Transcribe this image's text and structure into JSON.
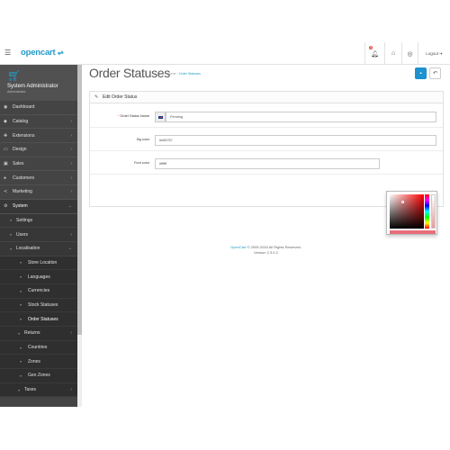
{
  "header": {
    "logo_text": "opencart",
    "logo_icon": "cart-icon",
    "alert_count": "3",
    "logout_label": "Logout"
  },
  "profile": {
    "name": "System Administrator",
    "role": "Administrator"
  },
  "sidebar": {
    "items": [
      {
        "label": "Dashboard",
        "icon": "dashboard-icon"
      },
      {
        "label": "Catalog",
        "icon": "tag-icon"
      },
      {
        "label": "Extensions",
        "icon": "puzzle-icon"
      },
      {
        "label": "Design",
        "icon": "monitor-icon"
      },
      {
        "label": "Sales",
        "icon": "cart-icon"
      },
      {
        "label": "Customers",
        "icon": "user-icon"
      },
      {
        "label": "Marketing",
        "icon": "share-icon"
      },
      {
        "label": "System",
        "icon": "gear-icon"
      }
    ],
    "system_children": [
      "Settings",
      "Users",
      "Localisation"
    ],
    "localisation_children": [
      "Store Location",
      "Languages",
      "Currencies",
      "Stock Statuses",
      "Order Statuses"
    ],
    "more_children": [
      "Returns",
      "Countries",
      "Zones",
      "Geo Zones",
      "Taxes"
    ]
  },
  "page": {
    "title": "Order Statuses",
    "breadcrumb": {
      "home": "Home",
      "separator": "›",
      "current": "Order Statuses"
    }
  },
  "panel": {
    "title": "Edit Order Status"
  },
  "form": {
    "status_name_label": "Order Status Name",
    "status_name_value": "Pending",
    "bg_color_label": "Bg color",
    "bg_color_value": "#e86767",
    "font_color_label": "Font color",
    "font_color_value": "#ffffff"
  },
  "footer": {
    "brand": "OpenCart",
    "copyright": "© 2009-2016 All Rights Reserved.",
    "version": "Version 2.3.0.2"
  },
  "colors": {
    "accent": "#1e91cf",
    "link": "#229ac8",
    "sidebar_bg": "#444444",
    "picker_preview": "#e86d7a"
  }
}
